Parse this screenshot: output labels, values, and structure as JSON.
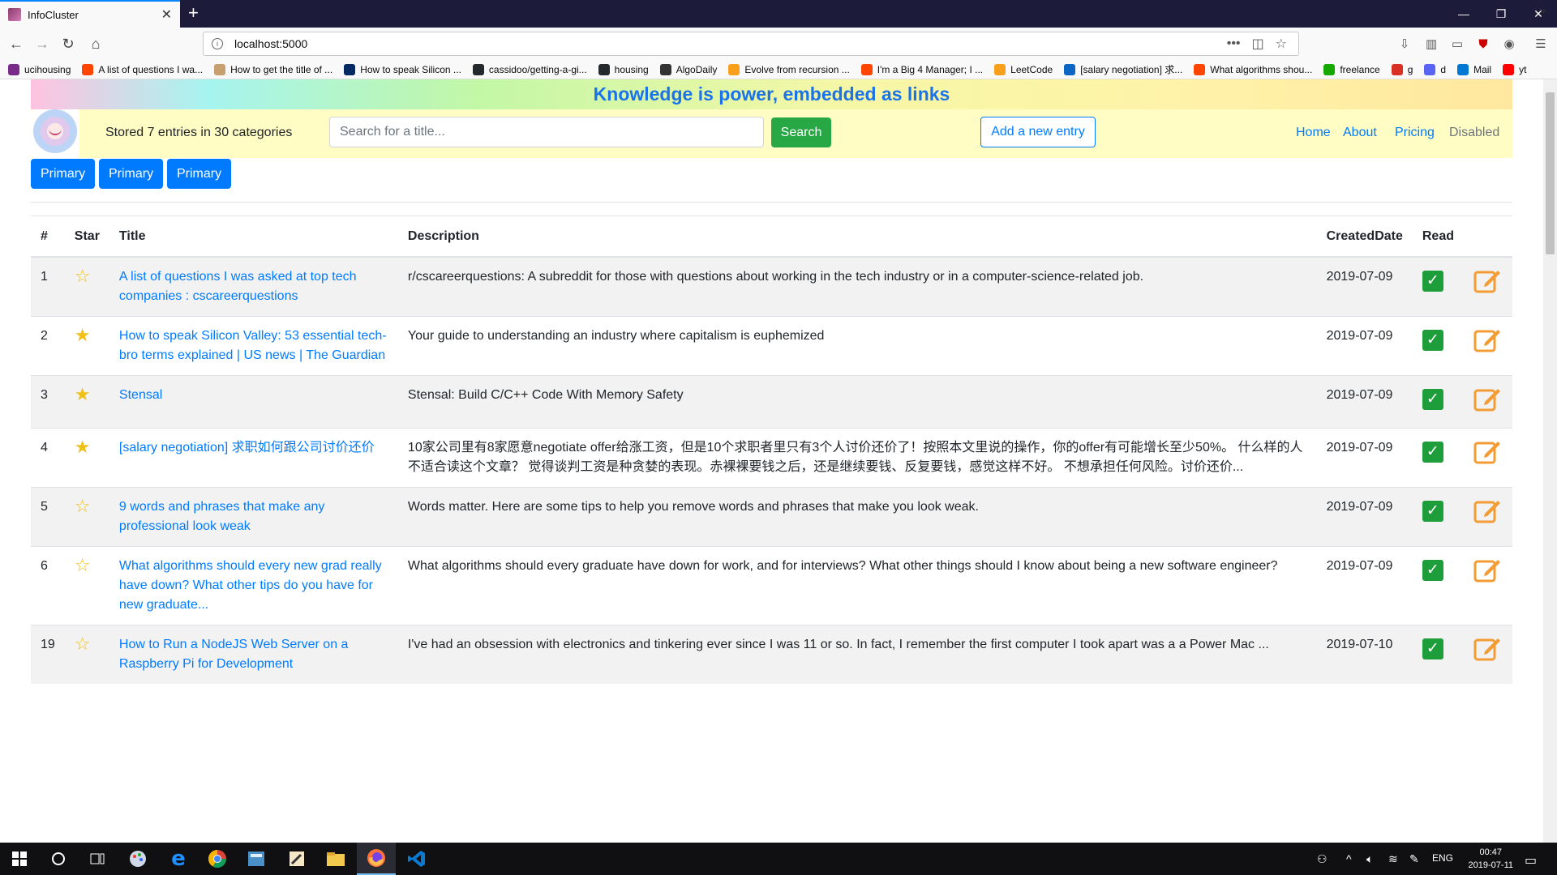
{
  "browser": {
    "tab_title": "InfoCluster",
    "url": "localhost:5000",
    "bookmarks": [
      {
        "label": "ucihousing",
        "icon": "uci-icon",
        "color": "#7a2a88"
      },
      {
        "label": "A list of questions I wa...",
        "icon": "reddit-icon",
        "color": "#ff4500"
      },
      {
        "label": "How to get the title of ...",
        "icon": "dev-icon",
        "color": "#c8a070"
      },
      {
        "label": "How to speak Silicon ...",
        "icon": "guardian-icon",
        "color": "#052962"
      },
      {
        "label": "cassidoo/getting-a-gi...",
        "icon": "github-icon",
        "color": "#24292e"
      },
      {
        "label": "housing",
        "icon": "github-icon",
        "color": "#24292e"
      },
      {
        "label": "AlgoDaily",
        "icon": "algodaily-icon",
        "color": "#333333"
      },
      {
        "label": "Evolve from recursion ...",
        "icon": "leetcode-icon",
        "color": "#f89f1b"
      },
      {
        "label": "I'm a Big 4 Manager; I ...",
        "icon": "reddit-icon",
        "color": "#ff4500"
      },
      {
        "label": "LeetCode",
        "icon": "leetcode-icon",
        "color": "#f89f1b"
      },
      {
        "label": "[salary negotiation] 求...",
        "icon": "linkedin-icon",
        "color": "#0a66c2"
      },
      {
        "label": "What algorithms shou...",
        "icon": "reddit-icon",
        "color": "#ff4500"
      },
      {
        "label": "freelance",
        "icon": "upwork-icon",
        "color": "#14a800"
      },
      {
        "label": "g",
        "icon": "gmail-icon",
        "color": "#d93025"
      },
      {
        "label": "d",
        "icon": "discord-icon",
        "color": "#5865f2"
      },
      {
        "label": "Mail",
        "icon": "outlook-icon",
        "color": "#0078d4"
      },
      {
        "label": "yt",
        "icon": "youtube-icon",
        "color": "#ff0000"
      }
    ]
  },
  "banner": {
    "text": "Knowledge is power, embedded as links"
  },
  "header": {
    "entry_count": "Stored 7 entries in 30 categories",
    "search_placeholder": "Search for a title...",
    "search_button": "Search",
    "add_button": "Add a new entry",
    "nav": [
      {
        "label": "Home",
        "disabled": false
      },
      {
        "label": "About",
        "disabled": false
      },
      {
        "label": "Pricing",
        "disabled": false
      },
      {
        "label": "Disabled",
        "disabled": true
      }
    ]
  },
  "primary_buttons": [
    "Primary",
    "Primary",
    "Primary"
  ],
  "table": {
    "headers": {
      "num": "#",
      "star": "Star",
      "title": "Title",
      "description": "Description",
      "date": "CreatedDate",
      "read": "Read"
    },
    "rows": [
      {
        "num": "1",
        "starred": false,
        "title": "A list of questions I was asked at top tech companies : cscareerquestions",
        "description": "r/cscareerquestions: A subreddit for those with questions about working in the tech industry or in a computer-science-related job.",
        "date": "2019-07-09",
        "read": true
      },
      {
        "num": "2",
        "starred": true,
        "title": "How to speak Silicon Valley: 53 essential tech-bro terms explained | US news | The Guardian",
        "description": "Your guide to understanding an industry where capitalism is euphemized",
        "date": "2019-07-09",
        "read": true
      },
      {
        "num": "3",
        "starred": true,
        "title": "Stensal",
        "description": "Stensal: Build C/C++ Code With Memory Safety",
        "date": "2019-07-09",
        "read": true
      },
      {
        "num": "4",
        "starred": true,
        "title": "[salary negotiation] 求职如何跟公司讨价还价",
        "description": "10家公司里有8家愿意negotiate offer给涨工资，但是10个求职者里只有3个人讨价还价了！按照本文里说的操作，你的offer有可能增长至少50%。 什么样的人不适合读这个文章？ 觉得谈判工资是种贪婪的表现。赤裸裸要钱之后，还是继续要钱、反复要钱，感觉这样不好。 不想承担任何风险。讨价还价...",
        "date": "2019-07-09",
        "read": true
      },
      {
        "num": "5",
        "starred": false,
        "title": "9 words and phrases that make any professional look weak",
        "description": "Words matter. Here are some tips to help you remove words and phrases that make you look weak.",
        "date": "2019-07-09",
        "read": true
      },
      {
        "num": "6",
        "starred": false,
        "title": "What algorithms should every new grad really have down? What other tips do you have for new graduate...",
        "description": "What algorithms should every graduate have down for work, and for interviews? What other things should I know about being a new software engineer?",
        "date": "2019-07-09",
        "read": true
      },
      {
        "num": "19",
        "starred": false,
        "title": "How to Run a NodeJS Web Server on a Raspberry Pi for Development",
        "description": "I've had an obsession with electronics and tinkering ever since I was 11 or so. In fact, I remember the first computer I took apart was a a Power Mac ...",
        "date": "2019-07-10",
        "read": true
      }
    ]
  },
  "taskbar": {
    "language": "ENG",
    "time": "00:47",
    "date": "2019-07-11"
  },
  "colors": {
    "primary": "#007bff",
    "success": "#28a745",
    "read_check": "#1e9e3a",
    "edit_icon": "#f39c34",
    "star": "#f0c01a"
  }
}
